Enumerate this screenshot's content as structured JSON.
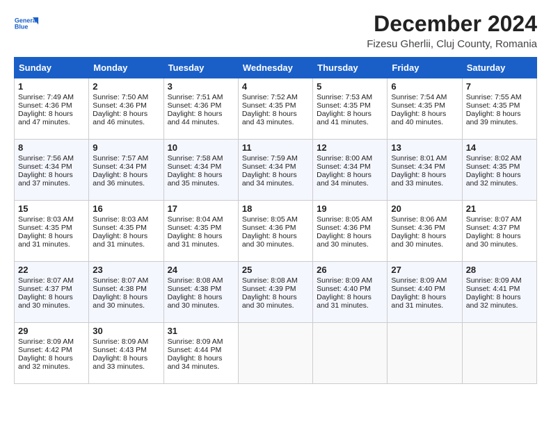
{
  "header": {
    "logo_line1": "General",
    "logo_line2": "Blue",
    "title": "December 2024",
    "subtitle": "Fizesu Gherlii, Cluj County, Romania"
  },
  "days_of_week": [
    "Sunday",
    "Monday",
    "Tuesday",
    "Wednesday",
    "Thursday",
    "Friday",
    "Saturday"
  ],
  "weeks": [
    [
      {
        "day": "1",
        "lines": [
          "Sunrise: 7:49 AM",
          "Sunset: 4:36 PM",
          "Daylight: 8 hours",
          "and 47 minutes."
        ]
      },
      {
        "day": "2",
        "lines": [
          "Sunrise: 7:50 AM",
          "Sunset: 4:36 PM",
          "Daylight: 8 hours",
          "and 46 minutes."
        ]
      },
      {
        "day": "3",
        "lines": [
          "Sunrise: 7:51 AM",
          "Sunset: 4:36 PM",
          "Daylight: 8 hours",
          "and 44 minutes."
        ]
      },
      {
        "day": "4",
        "lines": [
          "Sunrise: 7:52 AM",
          "Sunset: 4:35 PM",
          "Daylight: 8 hours",
          "and 43 minutes."
        ]
      },
      {
        "day": "5",
        "lines": [
          "Sunrise: 7:53 AM",
          "Sunset: 4:35 PM",
          "Daylight: 8 hours",
          "and 41 minutes."
        ]
      },
      {
        "day": "6",
        "lines": [
          "Sunrise: 7:54 AM",
          "Sunset: 4:35 PM",
          "Daylight: 8 hours",
          "and 40 minutes."
        ]
      },
      {
        "day": "7",
        "lines": [
          "Sunrise: 7:55 AM",
          "Sunset: 4:35 PM",
          "Daylight: 8 hours",
          "and 39 minutes."
        ]
      }
    ],
    [
      {
        "day": "8",
        "lines": [
          "Sunrise: 7:56 AM",
          "Sunset: 4:34 PM",
          "Daylight: 8 hours",
          "and 37 minutes."
        ]
      },
      {
        "day": "9",
        "lines": [
          "Sunrise: 7:57 AM",
          "Sunset: 4:34 PM",
          "Daylight: 8 hours",
          "and 36 minutes."
        ]
      },
      {
        "day": "10",
        "lines": [
          "Sunrise: 7:58 AM",
          "Sunset: 4:34 PM",
          "Daylight: 8 hours",
          "and 35 minutes."
        ]
      },
      {
        "day": "11",
        "lines": [
          "Sunrise: 7:59 AM",
          "Sunset: 4:34 PM",
          "Daylight: 8 hours",
          "and 34 minutes."
        ]
      },
      {
        "day": "12",
        "lines": [
          "Sunrise: 8:00 AM",
          "Sunset: 4:34 PM",
          "Daylight: 8 hours",
          "and 34 minutes."
        ]
      },
      {
        "day": "13",
        "lines": [
          "Sunrise: 8:01 AM",
          "Sunset: 4:34 PM",
          "Daylight: 8 hours",
          "and 33 minutes."
        ]
      },
      {
        "day": "14",
        "lines": [
          "Sunrise: 8:02 AM",
          "Sunset: 4:35 PM",
          "Daylight: 8 hours",
          "and 32 minutes."
        ]
      }
    ],
    [
      {
        "day": "15",
        "lines": [
          "Sunrise: 8:03 AM",
          "Sunset: 4:35 PM",
          "Daylight: 8 hours",
          "and 31 minutes."
        ]
      },
      {
        "day": "16",
        "lines": [
          "Sunrise: 8:03 AM",
          "Sunset: 4:35 PM",
          "Daylight: 8 hours",
          "and 31 minutes."
        ]
      },
      {
        "day": "17",
        "lines": [
          "Sunrise: 8:04 AM",
          "Sunset: 4:35 PM",
          "Daylight: 8 hours",
          "and 31 minutes."
        ]
      },
      {
        "day": "18",
        "lines": [
          "Sunrise: 8:05 AM",
          "Sunset: 4:36 PM",
          "Daylight: 8 hours",
          "and 30 minutes."
        ]
      },
      {
        "day": "19",
        "lines": [
          "Sunrise: 8:05 AM",
          "Sunset: 4:36 PM",
          "Daylight: 8 hours",
          "and 30 minutes."
        ]
      },
      {
        "day": "20",
        "lines": [
          "Sunrise: 8:06 AM",
          "Sunset: 4:36 PM",
          "Daylight: 8 hours",
          "and 30 minutes."
        ]
      },
      {
        "day": "21",
        "lines": [
          "Sunrise: 8:07 AM",
          "Sunset: 4:37 PM",
          "Daylight: 8 hours",
          "and 30 minutes."
        ]
      }
    ],
    [
      {
        "day": "22",
        "lines": [
          "Sunrise: 8:07 AM",
          "Sunset: 4:37 PM",
          "Daylight: 8 hours",
          "and 30 minutes."
        ]
      },
      {
        "day": "23",
        "lines": [
          "Sunrise: 8:07 AM",
          "Sunset: 4:38 PM",
          "Daylight: 8 hours",
          "and 30 minutes."
        ]
      },
      {
        "day": "24",
        "lines": [
          "Sunrise: 8:08 AM",
          "Sunset: 4:38 PM",
          "Daylight: 8 hours",
          "and 30 minutes."
        ]
      },
      {
        "day": "25",
        "lines": [
          "Sunrise: 8:08 AM",
          "Sunset: 4:39 PM",
          "Daylight: 8 hours",
          "and 30 minutes."
        ]
      },
      {
        "day": "26",
        "lines": [
          "Sunrise: 8:09 AM",
          "Sunset: 4:40 PM",
          "Daylight: 8 hours",
          "and 31 minutes."
        ]
      },
      {
        "day": "27",
        "lines": [
          "Sunrise: 8:09 AM",
          "Sunset: 4:40 PM",
          "Daylight: 8 hours",
          "and 31 minutes."
        ]
      },
      {
        "day": "28",
        "lines": [
          "Sunrise: 8:09 AM",
          "Sunset: 4:41 PM",
          "Daylight: 8 hours",
          "and 32 minutes."
        ]
      }
    ],
    [
      {
        "day": "29",
        "lines": [
          "Sunrise: 8:09 AM",
          "Sunset: 4:42 PM",
          "Daylight: 8 hours",
          "and 32 minutes."
        ]
      },
      {
        "day": "30",
        "lines": [
          "Sunrise: 8:09 AM",
          "Sunset: 4:43 PM",
          "Daylight: 8 hours",
          "and 33 minutes."
        ]
      },
      {
        "day": "31",
        "lines": [
          "Sunrise: 8:09 AM",
          "Sunset: 4:44 PM",
          "Daylight: 8 hours",
          "and 34 minutes."
        ]
      },
      {
        "day": "",
        "lines": []
      },
      {
        "day": "",
        "lines": []
      },
      {
        "day": "",
        "lines": []
      },
      {
        "day": "",
        "lines": []
      }
    ]
  ]
}
